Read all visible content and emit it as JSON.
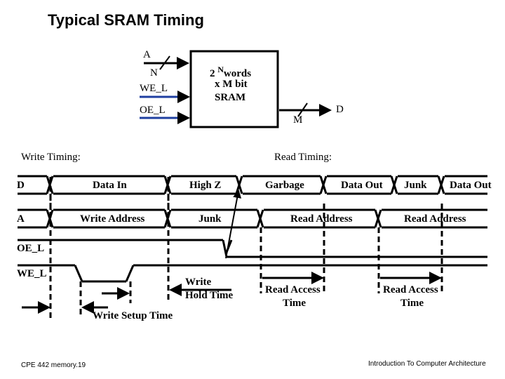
{
  "title": "Typical SRAM Timing",
  "block": {
    "line1": "2",
    "sup": "N",
    "line1b": "words",
    "line2": "x  M bit",
    "line3": "SRAM",
    "inputs": {
      "address": "A",
      "address_width": "N",
      "we": "WE_L",
      "oe": "OE_L"
    },
    "output": {
      "data": "D",
      "data_width": "M"
    },
    "control_line_color": "#1f3fa0"
  },
  "write_timing_label": "Write Timing:",
  "read_timing_label": "Read Timing:",
  "signals": {
    "d": "D",
    "a": "A",
    "oe": "OE_L",
    "we": "WE_L"
  },
  "d_bus": [
    "Data In",
    "High Z",
    "Garbage",
    "Data Out",
    "Junk",
    "Data Out"
  ],
  "a_bus": [
    "Write Address",
    "Junk",
    "Read Address",
    "Read Address"
  ],
  "annotations": {
    "write_setup": "Write Setup Time",
    "write_hold_1": "Write",
    "write_hold_2": "Hold Time",
    "read_access_1": "Read Access",
    "read_access_2": "Time"
  },
  "footer": {
    "left": "CPE 442  memory.19",
    "right": "Introduction To Computer Architecture"
  }
}
